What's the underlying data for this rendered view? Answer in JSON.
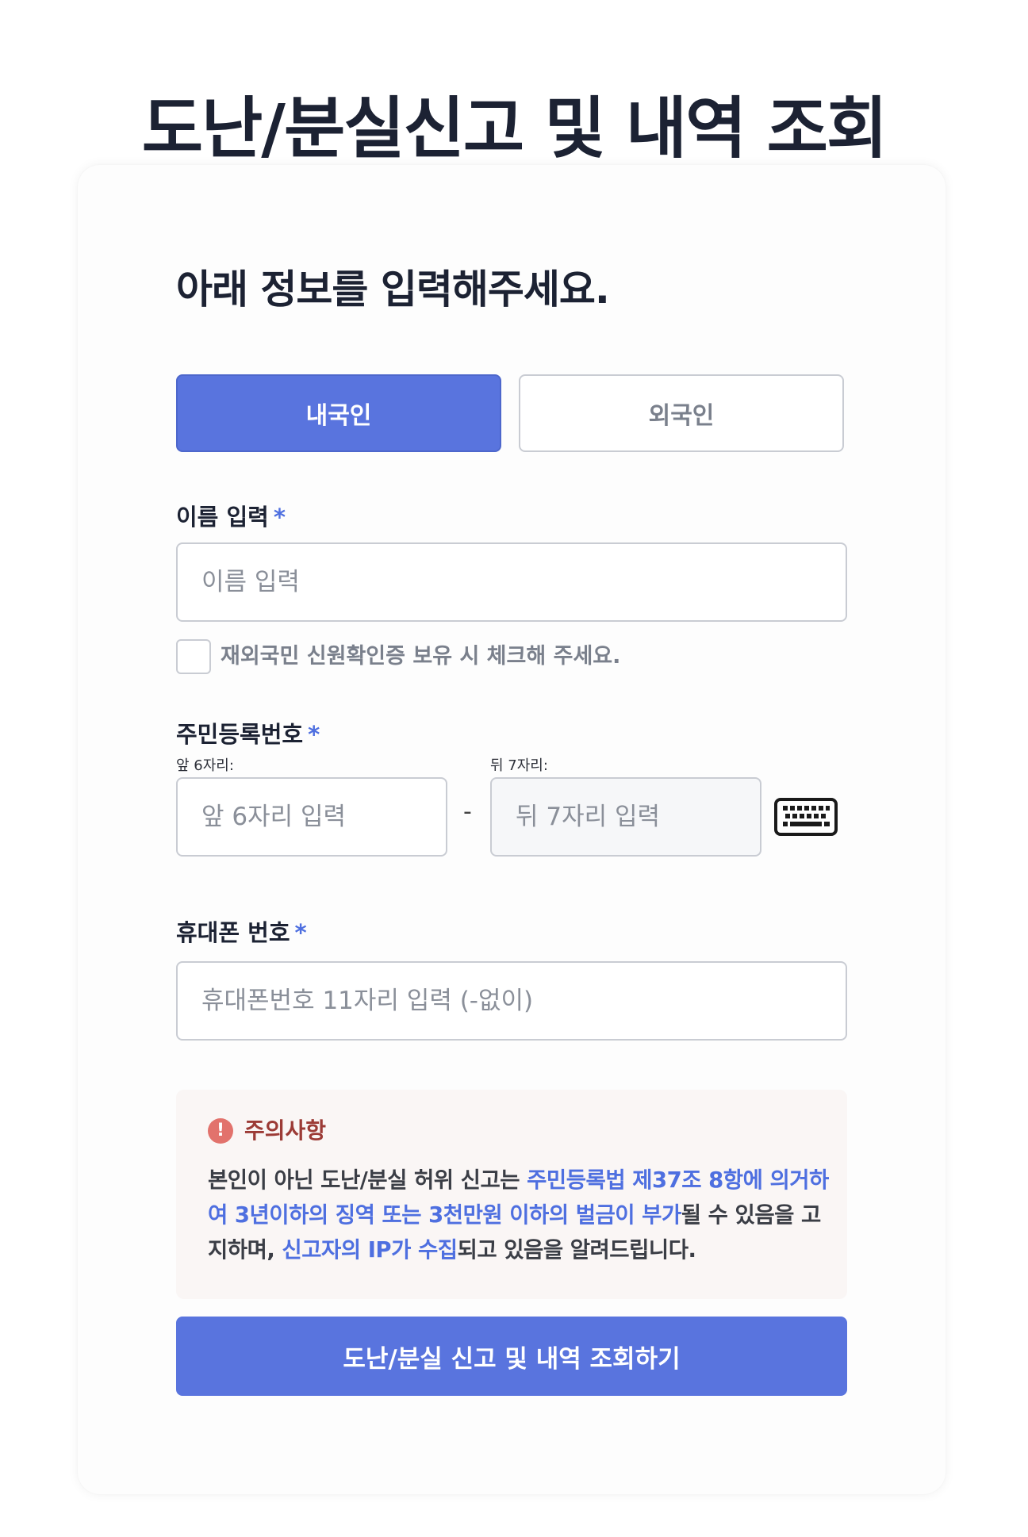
{
  "page": {
    "title": "도난/분실신고 및 내역 조회"
  },
  "form": {
    "heading": "아래 정보를 입력해주세요.",
    "tabs": [
      {
        "label": "내국인",
        "selected": true
      },
      {
        "label": "외국인",
        "selected": false
      }
    ],
    "required_mark": "*",
    "name": {
      "label": "이름 입력",
      "placeholder": "이름 입력",
      "value": ""
    },
    "overseas_checkbox": {
      "label": "재외국민 신원확인증 보유 시 체크해 주세요.",
      "checked": false
    },
    "rrn": {
      "label": "주민등록번호",
      "front_label": "앞 6자리:",
      "front_placeholder": "앞 6자리 입력",
      "back_label": "뒤 7자리:",
      "back_placeholder": "뒤 7자리 입력",
      "separator": "-",
      "keyboard_icon": "keyboard-icon"
    },
    "phone": {
      "label": "휴대폰 번호",
      "placeholder": "휴대폰번호 11자리 입력 (-없이)",
      "value": ""
    },
    "notice": {
      "icon": "alert-icon",
      "icon_glyph": "!",
      "title": "주의사항",
      "text_1": "본인이 아닌 도난/분실 허위 신고는 ",
      "highlight_1": "주민등록법 제37조 8항에 의거하여 3년이하의 징역 또는 3천만원 이하의 벌금이 부가",
      "text_2": "될 수 있음을 고지하며, ",
      "highlight_2": "신고자의 IP가 수집",
      "text_3": "되고 있음을 알려드립니다."
    },
    "submit_label": "도난/분실 신고 및 내역 조회하기"
  },
  "colors": {
    "primary": "#5974de",
    "highlight": "#4e6fe0",
    "notice_title": "#9c3b36",
    "notice_icon": "#e2726c",
    "notice_bg": "#faf6f5"
  }
}
